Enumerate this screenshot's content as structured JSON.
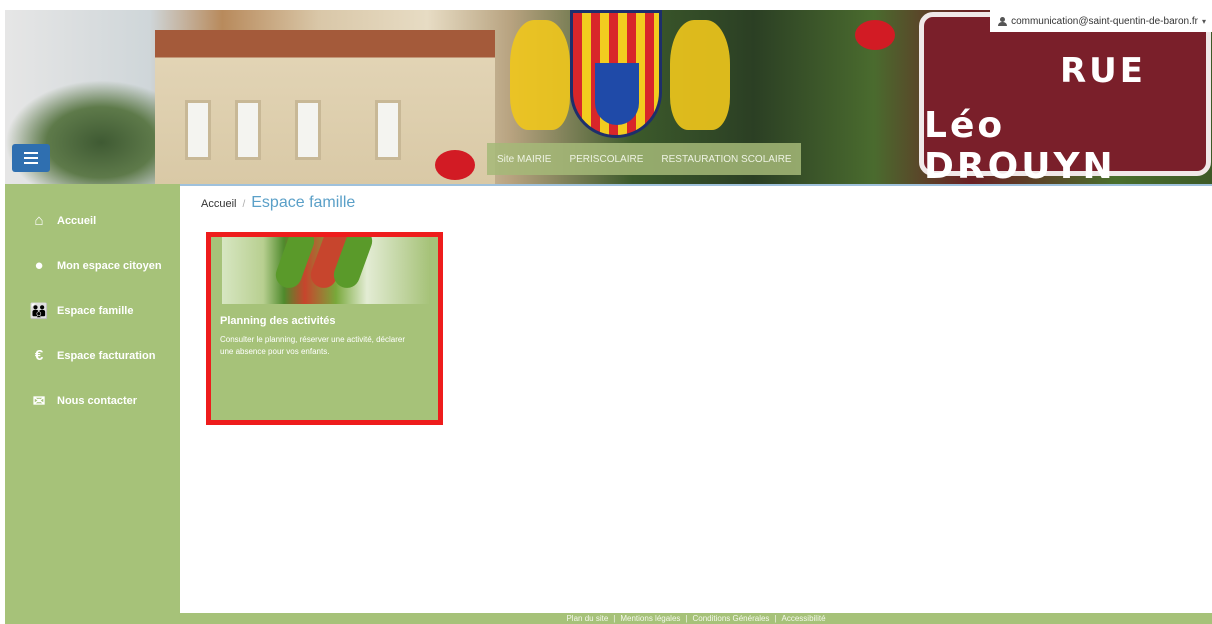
{
  "header": {
    "street_sign": {
      "line1": "RUE",
      "line2": "Léo DROUYN"
    }
  },
  "topnav": {
    "items": [
      "Site MAIRIE",
      "PERISCOLAIRE",
      "RESTAURATION SCOLAIRE"
    ]
  },
  "user": {
    "email": "communication@saint-quentin-de-baron.fr",
    "icon": "user-icon"
  },
  "sidebar": {
    "items": [
      {
        "label": "Accueil",
        "icon": "home-icon"
      },
      {
        "label": "Mon espace citoyen",
        "icon": "user-icon"
      },
      {
        "label": "Espace famille",
        "icon": "family-icon"
      },
      {
        "label": "Espace facturation",
        "icon": "euro-icon"
      },
      {
        "label": "Nous contacter",
        "icon": "envelope-icon"
      }
    ]
  },
  "breadcrumb": {
    "home": "Accueil",
    "separator": "/",
    "current": "Espace famille"
  },
  "card": {
    "title": "Planning des activités",
    "description": "Consulter le planning, réserver une activité, déclarer une absence pour vos enfants."
  },
  "footer": {
    "links": [
      "Plan du site",
      "Mentions légales",
      "Conditions Générales",
      "Accessibilité"
    ],
    "separator": "|"
  },
  "colors": {
    "sidebar_green": "#a6c279",
    "title_blue": "#5ba0c8",
    "highlight_red": "#ee1c1c",
    "menu_blue": "#2f6fb0"
  }
}
